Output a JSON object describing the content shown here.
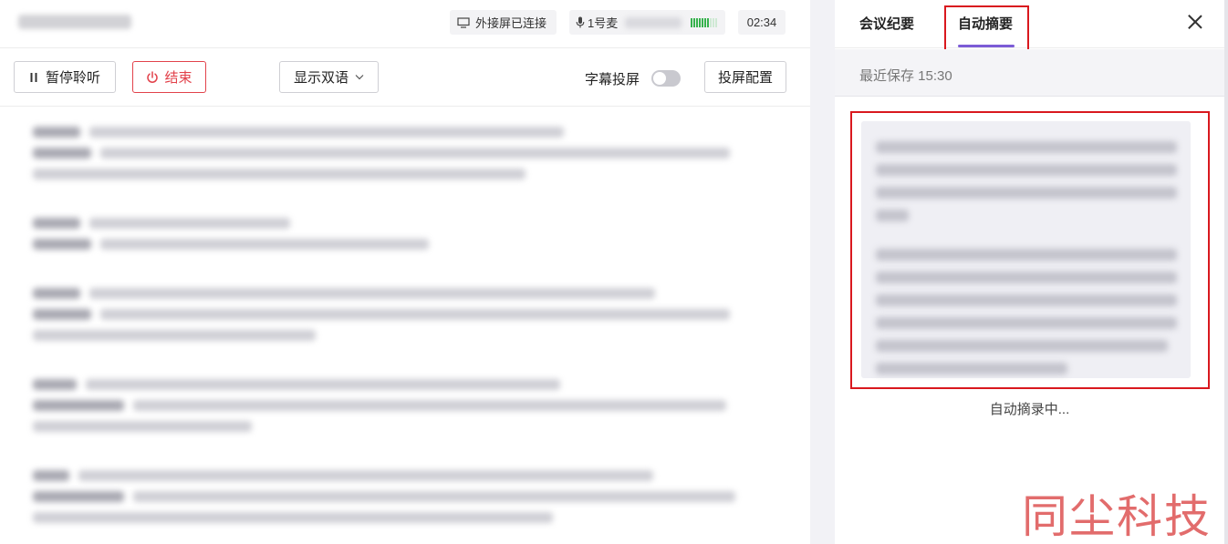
{
  "header": {
    "screen_status": "外接屏已连接",
    "mic_label": "1号麦",
    "timer": "02:34",
    "mic_level_fraction": 0.7
  },
  "toolbar": {
    "pause_label": "暂停聆听",
    "end_label": "结束",
    "bilingual_label": "显示双语",
    "subtitle_cast_label": "字幕投屏",
    "subtitle_cast_on": false,
    "cast_config_label": "投屏配置"
  },
  "sidebar": {
    "tabs": [
      {
        "label": "会议纪要",
        "active": false
      },
      {
        "label": "自动摘要",
        "active": true
      }
    ],
    "saved_text": "最近保存 15:30",
    "status_text": "自动摘录中..."
  },
  "watermark": "同尘科技",
  "colors": {
    "accent": "#7c5cd6",
    "danger": "#e2424b",
    "highlight_box": "#d9181e",
    "mic_level": "#37b24d"
  }
}
